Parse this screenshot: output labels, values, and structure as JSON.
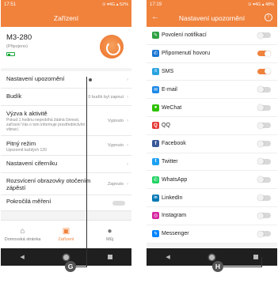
{
  "left": {
    "status_time": "17:51",
    "status_right": "⊙ ▾4G ▴ 52%",
    "title": "Zařízení",
    "device": {
      "name": "M3-280",
      "status": "(Připojeno)"
    },
    "settings": [
      {
        "title": "Nastavení upozornění",
        "sub": "",
        "value": ""
      },
      {
        "title": "Budík",
        "sub": "",
        "value": "0 budík byl zapnut"
      },
      {
        "title": "Výzva k aktivitě",
        "sub": "Pokud 1 hodinu neprobíhá žádná činnost, zařízení Vás o tom informuje prostřednictvím vibrací.",
        "value": "Vypnuto"
      },
      {
        "title": "Pitný režim",
        "sub": "Upozornit každých 120",
        "value": "Vypnuto"
      },
      {
        "title": "Nastavení ciferníku",
        "sub": "",
        "value": ""
      },
      {
        "title": "Rozsvícení obrazovky otočením zápěstí",
        "sub": "",
        "value": "Zapnuto"
      },
      {
        "title": "Pokročilá měření",
        "sub": "",
        "value": ""
      }
    ],
    "nav": [
      {
        "icon": "home-icon",
        "label": "Domovská stránka"
      },
      {
        "icon": "device-icon",
        "label": "Zařízení"
      },
      {
        "icon": "person-icon",
        "label": "Můj"
      }
    ]
  },
  "right": {
    "status_time": "17:19",
    "status_right": "⊙ ▾4G ▴ 48%",
    "title": "Nastavení upozornění",
    "items": [
      {
        "label": "Povolení notifikací",
        "icon": "notification-permission-icon",
        "color": "#2ea043",
        "glyph": "✎",
        "on": false
      },
      {
        "label": "Připomenutí hovoru",
        "icon": "phone-call-icon",
        "color": "#1976d2",
        "glyph": "✆",
        "on": true
      },
      {
        "label": "SMS",
        "icon": "sms-icon",
        "color": "#29a3e0",
        "glyph": "≡",
        "on": true
      },
      {
        "label": "E-mail",
        "icon": "email-icon",
        "color": "#1e88e5",
        "glyph": "✉",
        "on": false
      },
      {
        "label": "WeChat",
        "icon": "wechat-icon",
        "color": "#2dc100",
        "glyph": "●",
        "on": false
      },
      {
        "label": "QQ",
        "icon": "qq-icon",
        "color": "#e53935",
        "glyph": "Q",
        "on": false
      },
      {
        "label": "Facebook",
        "icon": "facebook-icon",
        "color": "#3b5998",
        "glyph": "f",
        "on": false
      },
      {
        "label": "Twitter",
        "icon": "twitter-icon",
        "color": "#1da1f2",
        "glyph": "t",
        "on": false
      },
      {
        "label": "WhatsApp",
        "icon": "whatsapp-icon",
        "color": "#25d366",
        "glyph": "✆",
        "on": false
      },
      {
        "label": "LinkedIn",
        "icon": "linkedin-icon",
        "color": "#0077b5",
        "glyph": "in",
        "on": false
      },
      {
        "label": "Instagram",
        "icon": "instagram-icon",
        "color": "#d6249f",
        "glyph": "◎",
        "on": false
      },
      {
        "label": "Messenger",
        "icon": "messenger-icon",
        "color": "#0084ff",
        "glyph": "ϟ",
        "on": false
      }
    ]
  },
  "callouts": {
    "g": "G",
    "h": "H"
  },
  "colors": {
    "accent": "#f0823c",
    "toggle_off": "#d8d8d8"
  }
}
